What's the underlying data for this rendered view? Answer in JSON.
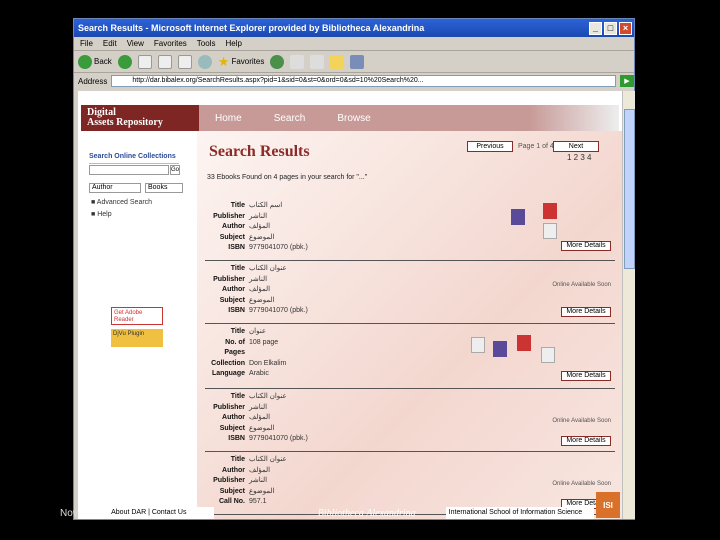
{
  "window": {
    "title": "Search Results - Microsoft Internet Explorer provided by Bibliotheca Alexandrina"
  },
  "menu": [
    "File",
    "Edit",
    "View",
    "Favorites",
    "Tools",
    "Help"
  ],
  "toolbar": {
    "back_label": "Back",
    "favorites_label": "Favorites"
  },
  "address": {
    "label": "Address",
    "url": "http://dar.bibalex.org/SearchResults.aspx?pid=1&sid=0&st=0&ord=0&sd=10%20Search%20..."
  },
  "site": {
    "logo_line1": "Digital",
    "logo_line2": "Assets Repository",
    "nav": [
      "Home",
      "Search",
      "Browse"
    ]
  },
  "sidebar": {
    "search_label": "Search Online Collections",
    "go_label": "Go",
    "field_select": "Author",
    "type_select": "Books",
    "advanced": "Advanced Search",
    "help": "Help",
    "badge1": "Get Adobe Reader",
    "badge2": "DjVu Plugin"
  },
  "results": {
    "heading": "Search Results",
    "prev_label": "Previous",
    "next_label": "Next",
    "page_text": "Page 1 of 4",
    "page_numbers": "1 2 3 4",
    "found_text": "33 Ebooks Found on 4 pages in your search for \"...\"",
    "more_label": "More Details",
    "sfx_label": "Online Available Soon",
    "records": [
      {
        "rows": [
          [
            "Title",
            "اسم الكتاب"
          ],
          [
            "Publisher",
            "الناشر"
          ],
          [
            "Author",
            "المؤلف"
          ],
          [
            "Subject",
            "الموضوع"
          ],
          [
            "ISBN",
            "9779041070 (pbk.)"
          ]
        ]
      },
      {
        "rows": [
          [
            "Title",
            "عنوان الكتاب"
          ],
          [
            "Publisher",
            "الناشر"
          ],
          [
            "Author",
            "المؤلف"
          ],
          [
            "Subject",
            "الموضوع"
          ],
          [
            "ISBN",
            "9779041070 (pbk.)"
          ]
        ]
      },
      {
        "rows": [
          [
            "Title",
            "عنوان"
          ],
          [
            "No. of",
            "108 page"
          ],
          [
            "Pages",
            ""
          ],
          [
            "Collection",
            "Don Elkalim"
          ],
          [
            "Language",
            "Arabic"
          ]
        ]
      },
      {
        "rows": [
          [
            "Title",
            "عنوان الكتاب"
          ],
          [
            "Publisher",
            "الناشر"
          ],
          [
            "Author",
            "المؤلف"
          ],
          [
            "Subject",
            "الموضوع"
          ],
          [
            "ISBN",
            "9779041070 (pbk.)"
          ]
        ]
      },
      {
        "rows": [
          [
            "Title",
            "عنوان الكتاب"
          ],
          [
            "Author",
            "المؤلف"
          ],
          [
            "Publisher",
            "الناشر"
          ],
          [
            "Subject",
            "الموضوع"
          ],
          [
            "Call No.",
            "957.1"
          ]
        ]
      }
    ]
  },
  "footer": {
    "left_text": "Nov",
    "about": "About DAR | Contact Us",
    "center": "Bibliotheca Alexandrina",
    "right": "International School of Information Science",
    "logo": "ISI"
  }
}
